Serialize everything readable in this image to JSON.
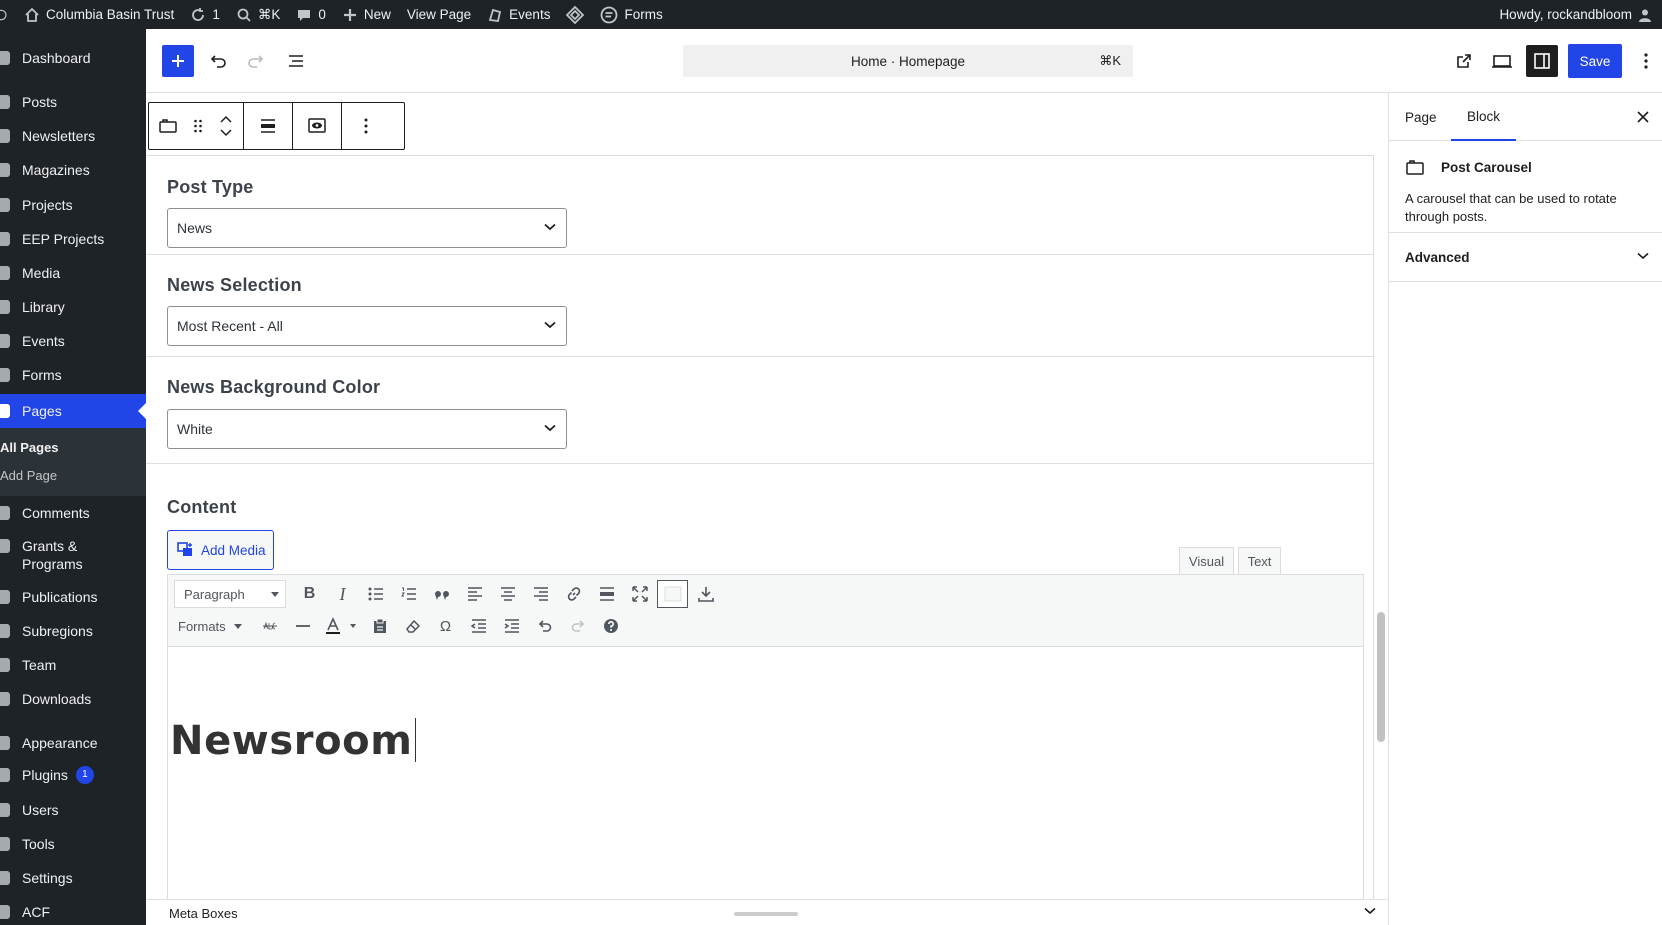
{
  "adminbar": {
    "site_name": "Columbia Basin Trust",
    "updates_count": "1",
    "search_shortcut": "⌘K",
    "comments_count": "0",
    "new_label": "New",
    "view_page_label": "View Page",
    "events_label": "Events",
    "forms_label": "Forms",
    "howdy_text": "Howdy, rockandbloom"
  },
  "sidebar": {
    "items": [
      {
        "label": "Dashboard"
      },
      {
        "label": "Posts"
      },
      {
        "label": "Newsletters"
      },
      {
        "label": "Magazines"
      },
      {
        "label": "Projects"
      },
      {
        "label": "EEP Projects"
      },
      {
        "label": "Media"
      },
      {
        "label": "Library"
      },
      {
        "label": "Events"
      },
      {
        "label": "Forms"
      },
      {
        "label": "Pages"
      },
      {
        "label": "Comments"
      },
      {
        "label": "Grants &"
      },
      {
        "label": "Programs"
      },
      {
        "label": "Publications"
      },
      {
        "label": "Subregions"
      },
      {
        "label": "Team"
      },
      {
        "label": "Downloads"
      },
      {
        "label": "Appearance"
      },
      {
        "label": "Plugins"
      },
      {
        "label": "Users"
      },
      {
        "label": "Tools"
      },
      {
        "label": "Settings"
      },
      {
        "label": "ACF"
      }
    ],
    "plugins_badge": "1",
    "submenu": {
      "all_pages": "All Pages",
      "add_page": "Add Page"
    }
  },
  "header": {
    "document_title": "Home · Homepage",
    "shortcut": "⌘K",
    "save_label": "Save"
  },
  "fields": {
    "post_type": {
      "label": "Post Type",
      "value": "News"
    },
    "news_selection": {
      "label": "News Selection",
      "value": "Most Recent - All"
    },
    "news_bg_color": {
      "label": "News Background Color",
      "value": "White"
    },
    "content": {
      "label": "Content"
    }
  },
  "editor": {
    "add_media_label": "Add Media",
    "tab_visual": "Visual",
    "tab_text": "Text",
    "format_select": "Paragraph",
    "formats_menu": "Formats",
    "content_heading": "Newsroom"
  },
  "metabox": {
    "title": "Meta Boxes"
  },
  "panel": {
    "tab_page": "Page",
    "tab_block": "Block",
    "block_title": "Post Carousel",
    "block_description": "A carousel that can be used to rotate through posts.",
    "advanced_label": "Advanced"
  },
  "colors": {
    "accent": "#2145e6",
    "adminbar_bg": "#1d2327"
  }
}
